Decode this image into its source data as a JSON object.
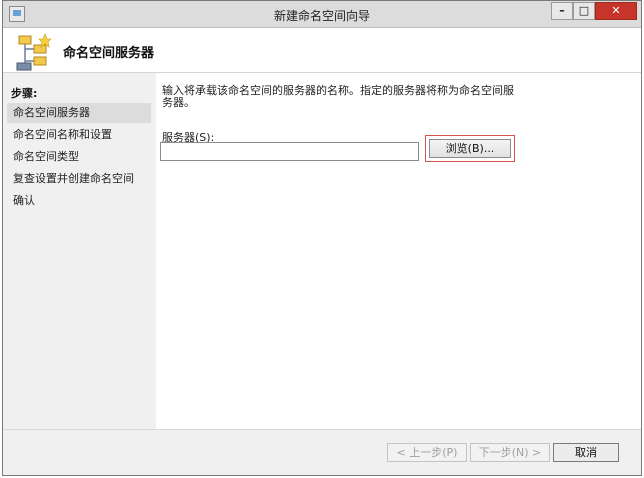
{
  "window": {
    "title": "新建命名空间向导",
    "controls": {
      "minimize": "–",
      "maximize": "□",
      "close": "✕"
    }
  },
  "header": {
    "heading": "命名空间服务器",
    "icon": "wizard-namespace-icon"
  },
  "steps": {
    "label": "步骤:",
    "items": [
      {
        "label": "命名空间服务器",
        "active": true
      },
      {
        "label": "命名空间名称和设置",
        "active": false
      },
      {
        "label": "命名空间类型",
        "active": false
      },
      {
        "label": "复查设置并创建命名空间",
        "active": false
      },
      {
        "label": "确认",
        "active": false
      }
    ]
  },
  "main": {
    "instructions": "输入将承载该命名空间的服务器的名称。指定的服务器将称为命名空间服务器。",
    "server_label": "服务器(S):",
    "server_value": "",
    "browse_label": "浏览(B)..."
  },
  "footer": {
    "prev_label": "< 上一步(P)",
    "next_label": "下一步(N) >",
    "cancel_label": "取消"
  },
  "colors": {
    "highlight_border": "#d9534f",
    "close_button": "#c7352a",
    "active_step": "#dcdcdc"
  }
}
